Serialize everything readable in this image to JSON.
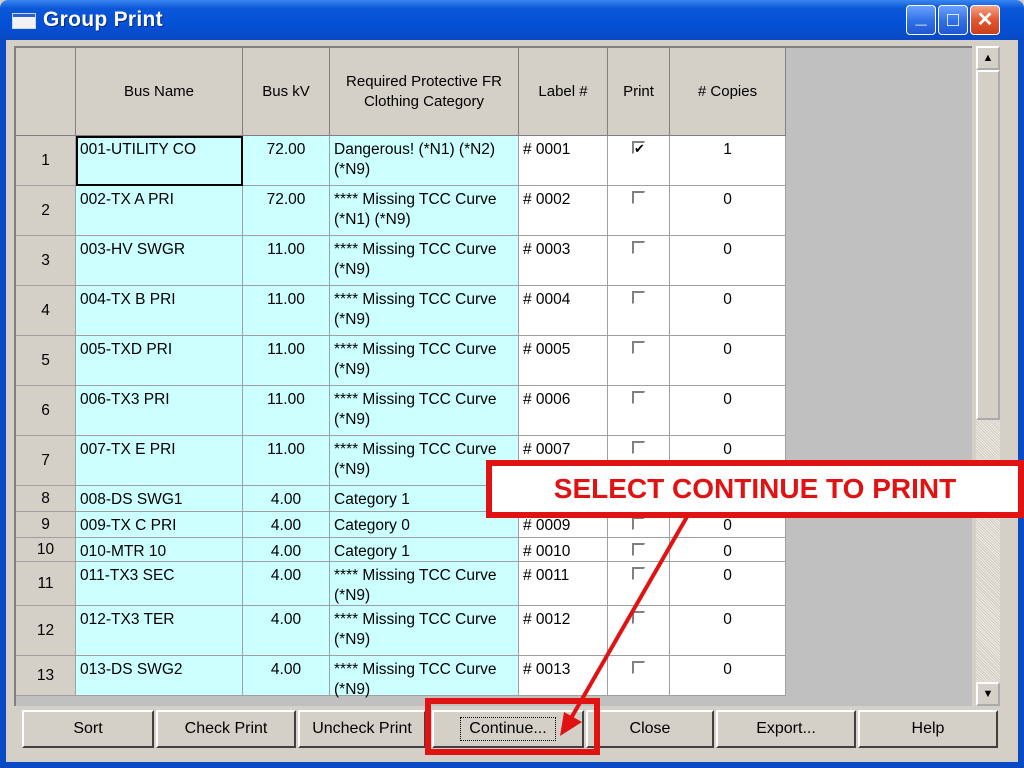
{
  "window": {
    "title": "Group Print",
    "controls": {
      "minimize": "_",
      "maximize": "□",
      "close": "✕"
    }
  },
  "grid": {
    "columns": [
      "",
      "Bus Name",
      "Bus kV",
      "Required Protective FR Clothing Category",
      "Label #",
      "Print",
      "# Copies"
    ],
    "rows": [
      {
        "n": "1",
        "name": "001-UTILITY CO",
        "kv": "72.00",
        "cat": "Dangerous! (*N1) (*N2) (*N9)",
        "label": "# 0001",
        "print": true,
        "copies": "1"
      },
      {
        "n": "2",
        "name": "002-TX A PRI",
        "kv": "72.00",
        "cat": "**** Missing TCC Curve (*N1) (*N9)",
        "label": "# 0002",
        "print": false,
        "copies": "0"
      },
      {
        "n": "3",
        "name": "003-HV SWGR",
        "kv": "11.00",
        "cat": "**** Missing TCC Curve (*N9)",
        "label": "# 0003",
        "print": false,
        "copies": "0"
      },
      {
        "n": "4",
        "name": "004-TX B PRI",
        "kv": "11.00",
        "cat": "**** Missing TCC Curve (*N9)",
        "label": "# 0004",
        "print": false,
        "copies": "0"
      },
      {
        "n": "5",
        "name": "005-TXD PRI",
        "kv": "11.00",
        "cat": "**** Missing TCC Curve (*N9)",
        "label": "# 0005",
        "print": false,
        "copies": "0"
      },
      {
        "n": "6",
        "name": "006-TX3 PRI",
        "kv": "11.00",
        "cat": "**** Missing TCC Curve (*N9)",
        "label": "# 0006",
        "print": false,
        "copies": "0"
      },
      {
        "n": "7",
        "name": "007-TX E PRI",
        "kv": "11.00",
        "cat": "**** Missing TCC Curve (*N9)",
        "label": "# 0007",
        "print": false,
        "copies": "0"
      },
      {
        "n": "8",
        "name": "008-DS SWG1",
        "kv": "4.00",
        "cat": "Category 1",
        "label": "",
        "print": false,
        "copies": ""
      },
      {
        "n": "9",
        "name": "009-TX C PRI",
        "kv": "4.00",
        "cat": "Category 0",
        "label": "# 0009",
        "print": false,
        "copies": "0"
      },
      {
        "n": "10",
        "name": "010-MTR 10",
        "kv": "4.00",
        "cat": "Category 1",
        "label": "# 0010",
        "print": false,
        "copies": "0"
      },
      {
        "n": "11",
        "name": "011-TX3 SEC",
        "kv": "4.00",
        "cat": "**** Missing TCC Curve (*N9)",
        "label": "# 0011",
        "print": false,
        "copies": "0"
      },
      {
        "n": "12",
        "name": "012-TX3 TER",
        "kv": "4.00",
        "cat": "**** Missing TCC Curve (*N9)",
        "label": "# 0012",
        "print": false,
        "copies": "0"
      },
      {
        "n": "13",
        "name": "013-DS SWG2",
        "kv": "4.00",
        "cat": "**** Missing TCC Curve (*N9)",
        "label": "# 0013",
        "print": false,
        "copies": "0"
      }
    ]
  },
  "buttons": [
    "Sort",
    "Check Print",
    "Uncheck Print",
    "Continue...",
    "Close",
    "Export...",
    "Help"
  ],
  "annotation": {
    "callout": "SELECT CONTINUE TO PRINT"
  },
  "colors": {
    "cell_cyan": "#ccffff",
    "callout_red": "#e01212",
    "titlebar_blue": "#0a4ac4"
  }
}
